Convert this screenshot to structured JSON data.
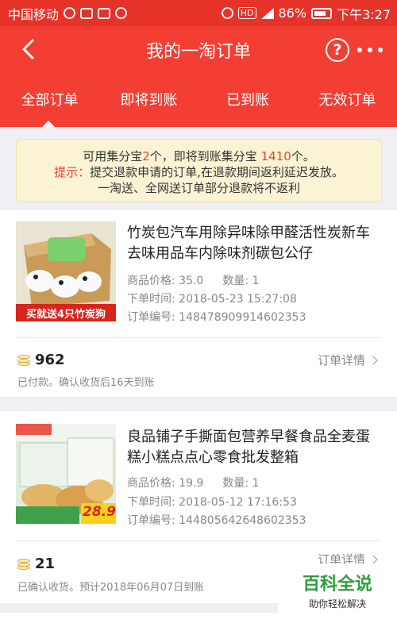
{
  "status_bar": {
    "carrier": "中国移动",
    "battery": "86%",
    "time": "下午3:27",
    "hd_badge": "HD"
  },
  "nav": {
    "title": "我的一淘订单",
    "help_symbol": "?"
  },
  "tabs": [
    {
      "label": "全部订单",
      "active": true
    },
    {
      "label": "即将到账",
      "active": false
    },
    {
      "label": "已到账",
      "active": false
    },
    {
      "label": "无效订单",
      "active": false
    }
  ],
  "notice": {
    "line1_a": "可用集分宝",
    "available": "2",
    "line1_b": "个，即将到账集分宝 ",
    "pending": "1410",
    "line1_c": "个。",
    "tip_label": "提示：",
    "tip_text": "提交退款申请的订单,在退款期间返利延迟发放。",
    "line3": "一淘送、全网送订单部分退款将不返利"
  },
  "orders": [
    {
      "title": "竹炭包汽车用除异味除甲醛活性炭新车去味用品车内除味剂碳包公仔",
      "price_label": "商品价格: 35.0",
      "qty_label": "数量: 1",
      "time_label": "下单时间: 2018-05-23 15:27:08",
      "order_no_label": "订单编号: 148478909914602353",
      "coins": "962",
      "status": "已付款。确认收货后16天到账",
      "detail_link": "订单详情",
      "thumb_banner": "买就送4只竹炭狗"
    },
    {
      "title": "良品铺子手撕面包营养早餐食品全麦蛋糕小糕点点心零食批发整箱",
      "price_label": "商品价格: 19.9",
      "qty_label": "数量: 1",
      "time_label": "下单时间: 2018-05-12 17:16:53",
      "order_no_label": "订单编号: 144805642648602353",
      "coins": "21",
      "status": "已确认收货。预计2018年06月07日到账",
      "detail_link": "订单详情",
      "thumb_price": "28.9"
    }
  ],
  "watermark": {
    "title": "百科全说",
    "subtitle": "助你轻松解决"
  },
  "colors": {
    "brand_red": "#f33e33",
    "status_red": "#e6332a",
    "coin_gold": "#e8a416",
    "notice_bg": "#fbf4d4"
  }
}
